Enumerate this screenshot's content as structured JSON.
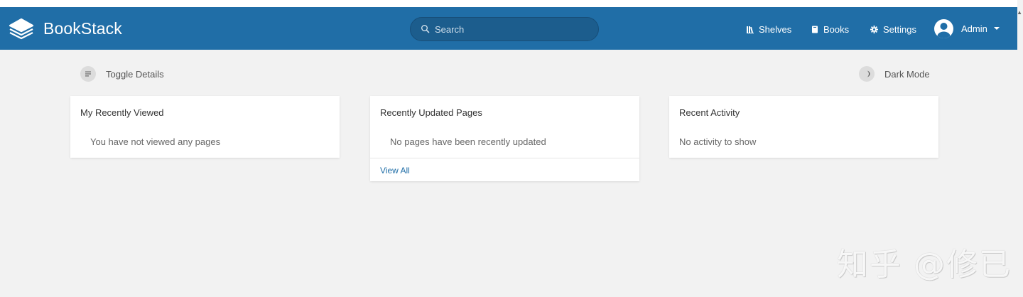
{
  "app": {
    "name": "BookStack"
  },
  "search": {
    "placeholder": "Search"
  },
  "nav": {
    "shelves": "Shelves",
    "books": "Books",
    "settings": "Settings",
    "user": "Admin"
  },
  "actions": {
    "toggle_details": "Toggle Details",
    "dark_mode": "Dark Mode"
  },
  "cards": {
    "recently_viewed": {
      "title": "My Recently Viewed",
      "empty": "You have not viewed any pages"
    },
    "recently_updated": {
      "title": "Recently Updated Pages",
      "empty": "No pages have been recently updated",
      "view_all": "View All"
    },
    "recent_activity": {
      "title": "Recent Activity",
      "empty": "No activity to show"
    }
  },
  "watermark": "知乎 @修已",
  "colors": {
    "header": "#206ea7",
    "background": "#f2f2f2",
    "link": "#206ea7"
  },
  "icons": [
    "bookstack-logo-icon",
    "search-icon",
    "shelves-icon",
    "books-icon",
    "gear-icon",
    "avatar-icon",
    "chevron-down-icon",
    "toggle-details-icon",
    "dark-mode-icon"
  ]
}
